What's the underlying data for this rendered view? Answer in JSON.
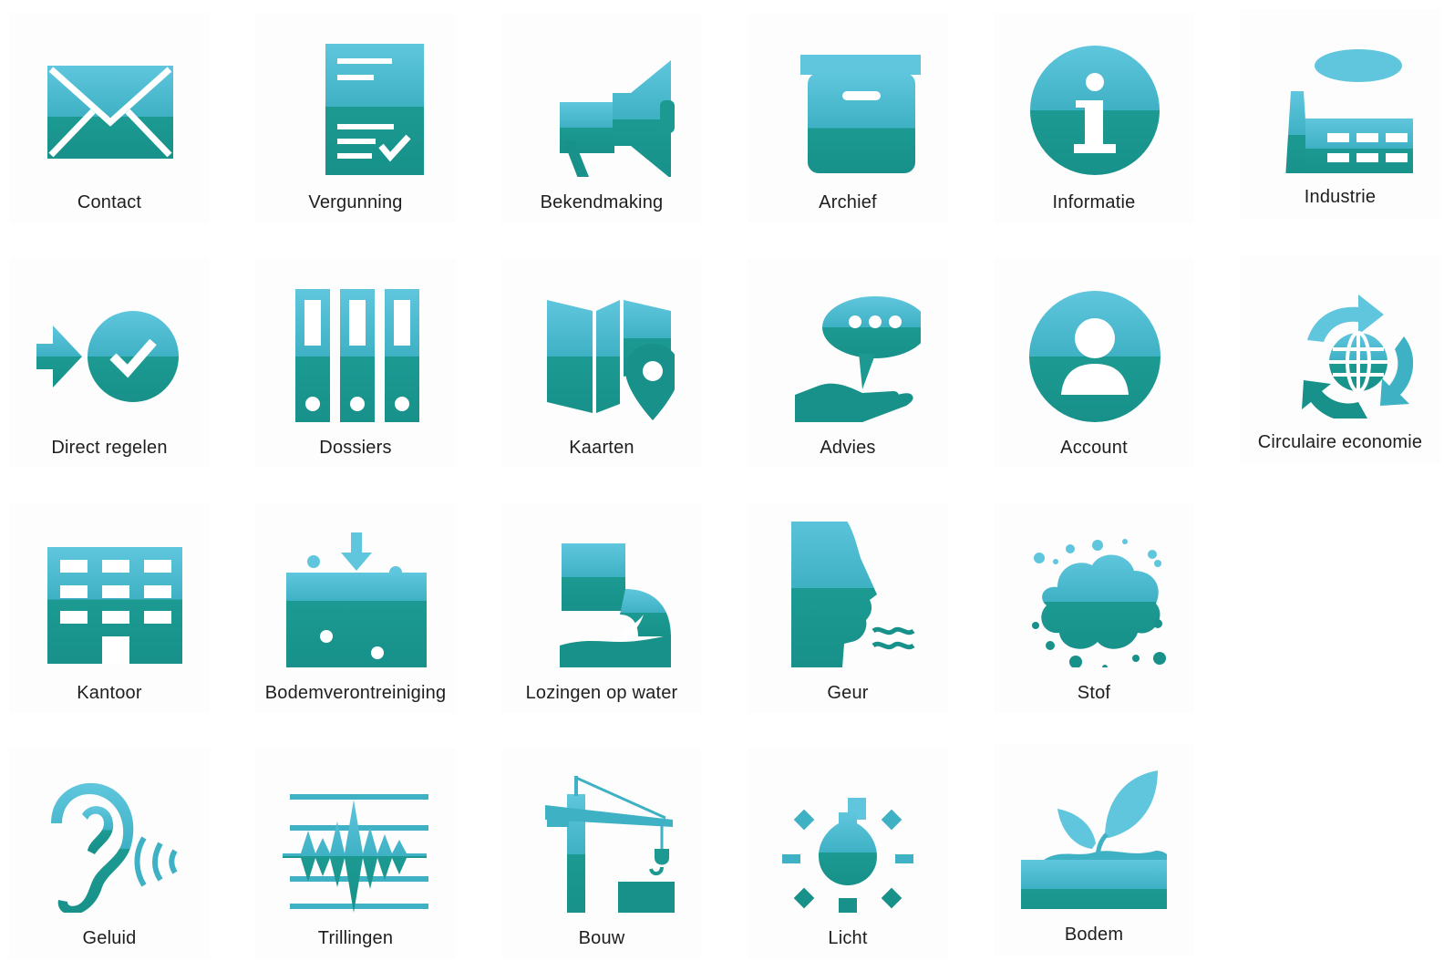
{
  "colors": {
    "teal_light": "#5fc6dd",
    "teal_dark": "#17918a",
    "background": "#ffffff",
    "label_text": "#1e1e1e"
  },
  "tiles": [
    {
      "label": "Contact",
      "icon": "envelope-icon"
    },
    {
      "label": "Vergunning",
      "icon": "permit-document-icon"
    },
    {
      "label": "Bekendmaking",
      "icon": "megaphone-icon"
    },
    {
      "label": "Archief",
      "icon": "archive-box-icon"
    },
    {
      "label": "Informatie",
      "icon": "info-icon"
    },
    {
      "label": "Industrie",
      "icon": "factory-icon"
    },
    {
      "label": "Direct regelen",
      "icon": "arrow-check-icon"
    },
    {
      "label": "Dossiers",
      "icon": "binders-icon"
    },
    {
      "label": "Kaarten",
      "icon": "map-pin-icon"
    },
    {
      "label": "Advies",
      "icon": "advice-hand-icon"
    },
    {
      "label": "Account",
      "icon": "user-account-icon"
    },
    {
      "label": "Circulaire economie",
      "icon": "circular-economy-icon"
    },
    {
      "label": "Kantoor",
      "icon": "office-building-icon"
    },
    {
      "label": "Bodemverontreiniging",
      "icon": "soil-pollution-icon"
    },
    {
      "label": "Lozingen op water",
      "icon": "water-discharge-icon"
    },
    {
      "label": "Geur",
      "icon": "smell-face-icon"
    },
    {
      "label": "Stof",
      "icon": "dust-cloud-icon"
    },
    {
      "label": "Geluid",
      "icon": "ear-sound-icon"
    },
    {
      "label": "Trillingen",
      "icon": "vibration-icon"
    },
    {
      "label": "Bouw",
      "icon": "crane-icon"
    },
    {
      "label": "Licht",
      "icon": "light-bulb-icon"
    },
    {
      "label": "Bodem",
      "icon": "plant-soil-icon"
    }
  ]
}
